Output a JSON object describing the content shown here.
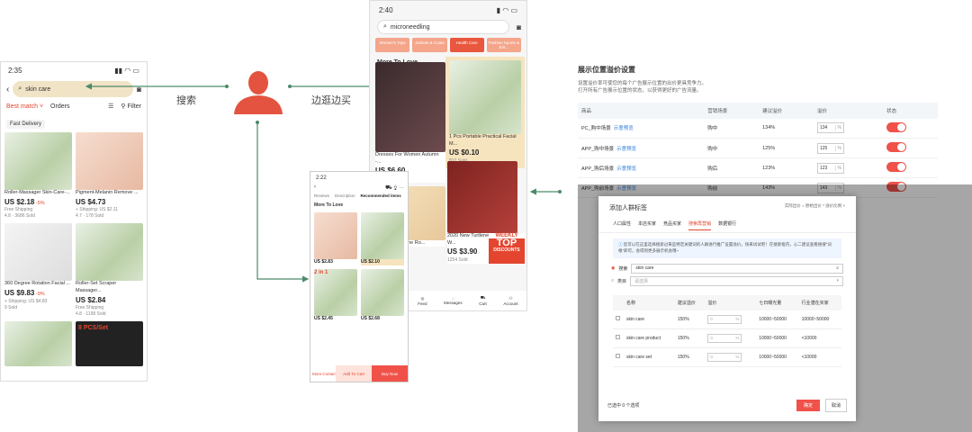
{
  "phone1": {
    "time": "2:35",
    "search_value": "skin care",
    "tab_best": "Best match ˅",
    "tab_orders": "Orders",
    "filter": "Filter",
    "chip": "Fast Delivery",
    "products": [
      {
        "title": "Roller-Massager Skin-Care-...",
        "price": "US $2.18",
        "badge": "-5%",
        "ship": "Free Shipping",
        "meta": "4.8 · 3686 Sold"
      },
      {
        "title": "Pigment-Melanin Remove ...",
        "price": "US $4.73",
        "badge": "",
        "ship": "+ Shipping: US $2.11",
        "meta": "4.7 · 178 Sold"
      },
      {
        "title": "360 Degree Rotation Facial ...",
        "price": "US $9.83",
        "badge": "-9%",
        "ship": "+ Shipping: US $4.83",
        "meta": "9 Sold"
      },
      {
        "title": "Roller-Set Scraper Massager...",
        "price": "US $2.84",
        "badge": "",
        "ship": "Free Shipping",
        "meta": "4.8 · 1198 Sold"
      }
    ],
    "banner": "8 PCS/Set"
  },
  "phone2": {
    "time": "2:40",
    "search_value": "microneedling",
    "cats": [
      "Women's Tops",
      "Jackets & Coats",
      "Health Care",
      "Fashion Sports & Ent..."
    ],
    "more": "More To Love",
    "items": [
      {
        "title": "Dresses For Women Autumn -...",
        "price": "US $6.60",
        "meta": "344 Sold"
      },
      {
        "title": "1 Pcs Portable Practical Facial M...",
        "price": "US $0.10",
        "meta": "817 Sold"
      },
      {
        "title": "Shaving machine Ro...",
        "price": "",
        "meta": ""
      },
      {
        "title": "2020 New Turtleneck Loose W...",
        "price": "US $3.90",
        "meta": "1254 Sold"
      }
    ],
    "weekly": "WEEKLY",
    "top": "TOP",
    "discounts": "DISCOUNTS",
    "nav": [
      "Feed",
      "Messages",
      "Cart",
      "Account"
    ]
  },
  "phone3": {
    "time": "2:22",
    "nav": [
      "Reviews",
      "Description",
      "Recommended items"
    ],
    "more": "More To Love",
    "prices": [
      "US $2.83",
      "US $2.10",
      "US $2.45",
      "US $2.68"
    ],
    "badge": "2 in 1",
    "store": "Store",
    "contact": "Contact",
    "add": "Add To Cart",
    "buy": "Buy Now"
  },
  "labels": {
    "search": "搜索",
    "browse": "边逛边买"
  },
  "panel": {
    "title": "展示位置溢价设置",
    "desc1": "设置溢价率可使您的每个广告展示位置的出价更具竞争力。",
    "desc2": "打开所有广告展示位置的状态，以获得更好的广告流量。",
    "headers": [
      "商品",
      "营销场景",
      "建议溢价",
      "溢价",
      "状态"
    ],
    "rows": [
      {
        "name": "PC_购中场景",
        "link": "示意预览",
        "scene": "购中",
        "sugg": "134%",
        "val": "134"
      },
      {
        "name": "APP_购中场景",
        "link": "示意预览",
        "scene": "购中",
        "sugg": "125%",
        "val": "125"
      },
      {
        "name": "APP_购后场景",
        "link": "示意预览",
        "scene": "购后",
        "sugg": "123%",
        "val": "123"
      },
      {
        "name": "APP_购前场景",
        "link": "示意预览",
        "scene": "购前",
        "sugg": "143%",
        "val": "143"
      }
    ],
    "pct": "%"
  },
  "modal": {
    "title": "添加人群标签",
    "crumb": "实际出价 = 原始出价 * 溢价比例",
    "tabs": [
      "人口属性",
      "本店买家",
      "竞品买家",
      "搜索再营销",
      "数据银行"
    ],
    "info": "您可以在这里选择搜索过来些特定关键词的人群进行推广设置溢价。快来试试吧！在搜索框内，心二建议查看搜搜“词根”即可，会得到更多展示机会哦~",
    "radio1": "搜索",
    "search": "skin care",
    "radio2": "类目",
    "select": "请选择",
    "cols": [
      "名称",
      "建议溢价",
      "溢价",
      "七日曝光量",
      "行业潜在买家"
    ],
    "rows": [
      {
        "name": "skin care",
        "sugg": "150%",
        "exp": "10000~50000",
        "buyers": "10000~50000"
      },
      {
        "name": "skin care product",
        "sugg": "150%",
        "exp": "10000~50000",
        "buyers": "<10000"
      },
      {
        "name": "skin care set",
        "sugg": "150%",
        "exp": "10000~50000",
        "buyers": "<10000"
      }
    ],
    "selected": "已选中 0 个选项",
    "ok": "确定",
    "cancel": "取消"
  },
  "colors": {
    "accent": "#e3452f",
    "highlight": "#f6e4bf",
    "arrow": "#4d8a6a"
  }
}
